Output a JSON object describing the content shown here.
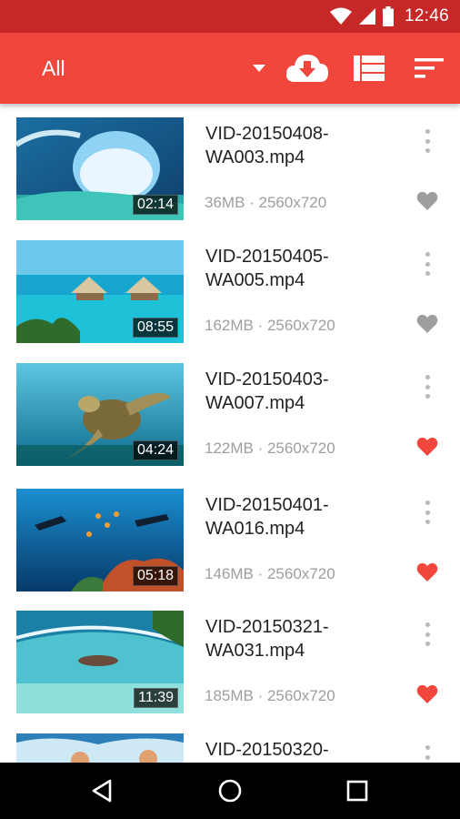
{
  "status_bar": {
    "time": "12:46",
    "icons": [
      "wifi-icon",
      "signal-icon",
      "battery-icon"
    ]
  },
  "toolbar": {
    "title": "All",
    "actions": [
      "download-cloud-icon",
      "list-view-icon",
      "sort-icon"
    ]
  },
  "colors": {
    "toolbar": "#f0463b",
    "status_bar": "#c62828",
    "favorite_on": "#f0463b",
    "favorite_off": "#9e9e9e"
  },
  "videos": [
    {
      "name_line1": "VID-20150408-",
      "name_line2": "WA003.mp4",
      "size": "36MB",
      "resolution": "2560x720",
      "meta": "36MB · 2560x720",
      "duration": "02:14",
      "favorite": false
    },
    {
      "name_line1": "VID-20150405-",
      "name_line2": "WA005.mp4",
      "size": "162MB",
      "resolution": "2560x720",
      "meta": "162MB · 2560x720",
      "duration": "08:55",
      "favorite": false
    },
    {
      "name_line1": "VID-20150403-",
      "name_line2": "WA007.mp4",
      "size": "122MB",
      "resolution": "2560x720",
      "meta": "122MB · 2560x720",
      "duration": "04:24",
      "favorite": true
    },
    {
      "name_line1": "VID-20150401-",
      "name_line2": "WA016.mp4",
      "size": "146MB",
      "resolution": "2560x720",
      "meta": "146MB · 2560x720",
      "duration": "05:18",
      "favorite": true
    },
    {
      "name_line1": "VID-20150321-",
      "name_line2": "WA031.mp4",
      "size": "185MB",
      "resolution": "2560x720",
      "meta": "185MB · 2560x720",
      "duration": "11:39",
      "favorite": true
    },
    {
      "name_line1": "VID-20150320-",
      "name_line2": "",
      "size": "",
      "resolution": "",
      "meta": "",
      "duration": "",
      "favorite": false
    }
  ],
  "nav": [
    "back-icon",
    "home-icon",
    "recents-icon"
  ]
}
